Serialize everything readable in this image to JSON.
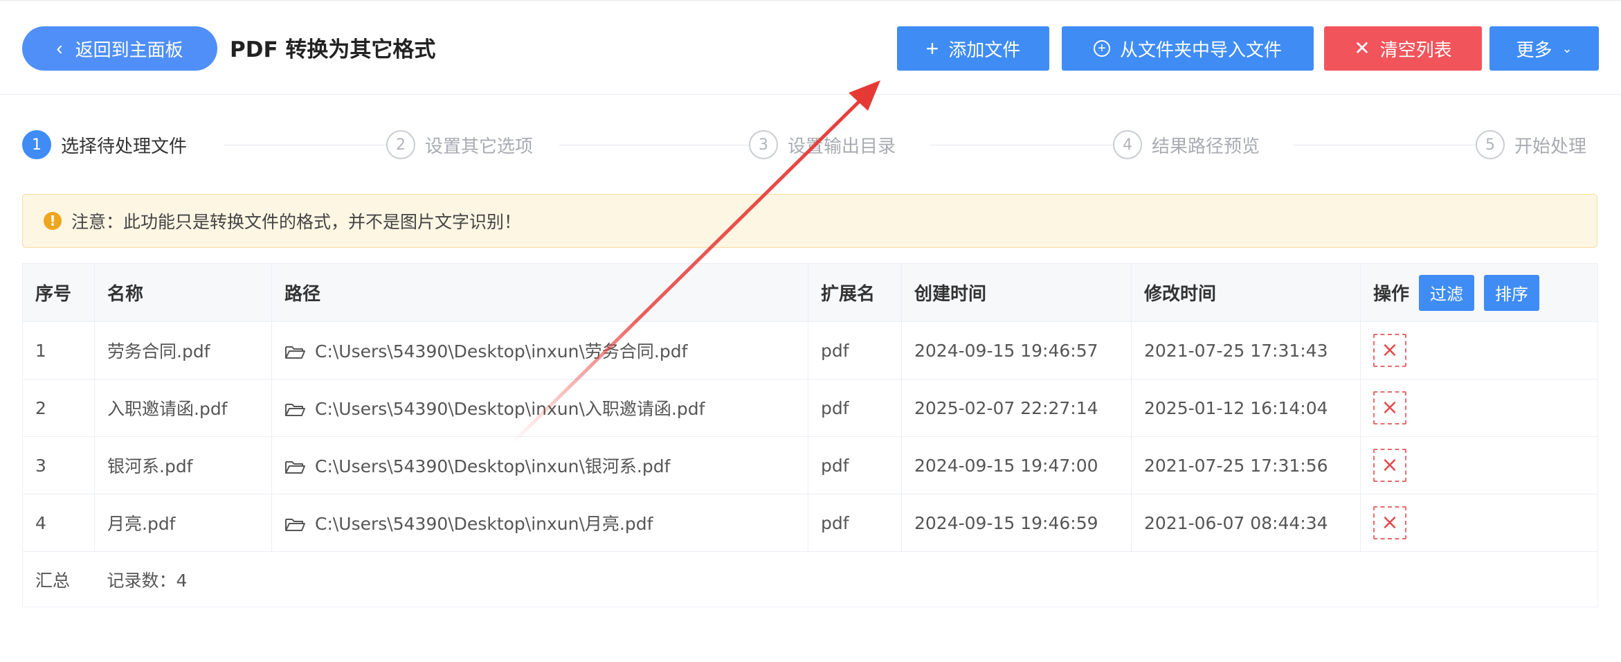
{
  "header": {
    "back_label": "返回到主面板",
    "title": "PDF 转换为其它格式",
    "add_file_label": "添加文件",
    "import_folder_label": "从文件夹中导入文件",
    "clear_list_label": "清空列表",
    "more_label": "更多"
  },
  "steps": [
    {
      "num": "1",
      "label": "选择待处理文件"
    },
    {
      "num": "2",
      "label": "设置其它选项"
    },
    {
      "num": "3",
      "label": "设置输出目录"
    },
    {
      "num": "4",
      "label": "结果路径预览"
    },
    {
      "num": "5",
      "label": "开始处理"
    }
  ],
  "notice": {
    "text": "注意：此功能只是转换文件的格式，并不是图片文字识别！"
  },
  "table": {
    "columns": {
      "index": "序号",
      "name": "名称",
      "path": "路径",
      "ext": "扩展名",
      "created": "创建时间",
      "modified": "修改时间",
      "actions": "操作"
    },
    "filter_label": "过滤",
    "sort_label": "排序",
    "rows": [
      {
        "index": "1",
        "name": "劳务合同.pdf",
        "path": "C:\\Users\\54390\\Desktop\\inxun\\劳务合同.pdf",
        "ext": "pdf",
        "created": "2024-09-15 19:46:57",
        "modified": "2021-07-25 17:31:43"
      },
      {
        "index": "2",
        "name": "入职邀请函.pdf",
        "path": "C:\\Users\\54390\\Desktop\\inxun\\入职邀请函.pdf",
        "ext": "pdf",
        "created": "2025-02-07 22:27:14",
        "modified": "2025-01-12 16:14:04"
      },
      {
        "index": "3",
        "name": "银河系.pdf",
        "path": "C:\\Users\\54390\\Desktop\\inxun\\银河系.pdf",
        "ext": "pdf",
        "created": "2024-09-15 19:47:00",
        "modified": "2021-07-25 17:31:56"
      },
      {
        "index": "4",
        "name": "月亮.pdf",
        "path": "C:\\Users\\54390\\Desktop\\inxun\\月亮.pdf",
        "ext": "pdf",
        "created": "2024-09-15 19:46:59",
        "modified": "2021-06-07 08:44:34"
      }
    ],
    "footer": {
      "label": "汇总",
      "count_text": "记录数：4"
    }
  },
  "colors": {
    "primary": "#3f8cf5",
    "danger": "#f2545b",
    "annotation_arrow": "#e53935"
  }
}
